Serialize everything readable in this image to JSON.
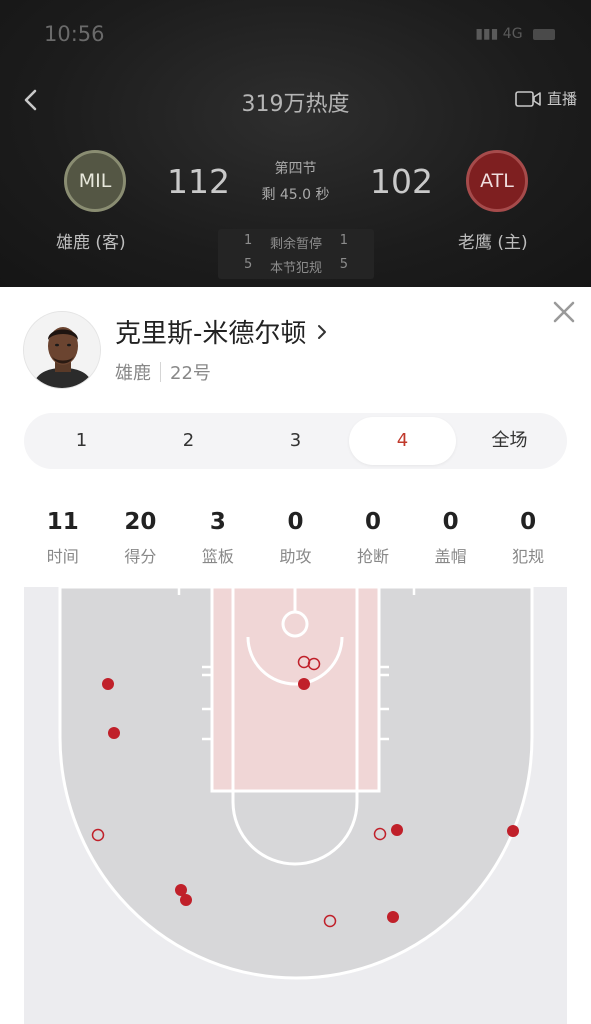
{
  "status_bar": {
    "time": "10:56",
    "network": "4G"
  },
  "header": {
    "title": "319万热度",
    "live_label": "直播",
    "away": {
      "abbr": "MIL",
      "name": "雄鹿 (客)",
      "score": "112",
      "color": "#545644"
    },
    "home": {
      "abbr": "ATL",
      "name": "老鹰 (主)",
      "score": "102",
      "color": "#7e1f20"
    },
    "period": "第四节",
    "clock": "剩 45.0 秒",
    "timeouts": {
      "away": "1",
      "label": "剩余暂停",
      "home": "1"
    },
    "fouls": {
      "away": "5",
      "label": "本节犯规",
      "home": "5"
    }
  },
  "player": {
    "name": "克里斯-米德尔顿",
    "team": "雄鹿",
    "number": "22号"
  },
  "period_tabs": [
    {
      "label": "1",
      "active": false
    },
    {
      "label": "2",
      "active": false
    },
    {
      "label": "3",
      "active": false
    },
    {
      "label": "4",
      "active": true
    },
    {
      "label": "全场",
      "active": false
    }
  ],
  "stats": [
    {
      "value": "11",
      "label": "时间"
    },
    {
      "value": "20",
      "label": "得分"
    },
    {
      "value": "3",
      "label": "篮板"
    },
    {
      "value": "0",
      "label": "助攻"
    },
    {
      "value": "0",
      "label": "抢断"
    },
    {
      "value": "0",
      "label": "盖帽"
    },
    {
      "value": "0",
      "label": "犯规"
    }
  ],
  "colors": {
    "accent": "#c0392b",
    "made_shot": "#c0202a",
    "paint": "#f0d6d6",
    "court_inside_arc": "#d7d7d9",
    "court_outside_arc": "#ececef"
  },
  "shot_chart": {
    "legend": {
      "made": "filled red dot",
      "missed": "hollow red circle"
    },
    "shots": [
      {
        "made": true
      },
      {
        "made": true
      },
      {
        "made": true
      },
      {
        "made": true
      },
      {
        "made": true
      },
      {
        "made": true
      },
      {
        "made": true
      },
      {
        "made": true
      },
      {
        "made": false
      },
      {
        "made": false
      },
      {
        "made": false
      },
      {
        "made": false
      },
      {
        "made": false
      }
    ]
  }
}
